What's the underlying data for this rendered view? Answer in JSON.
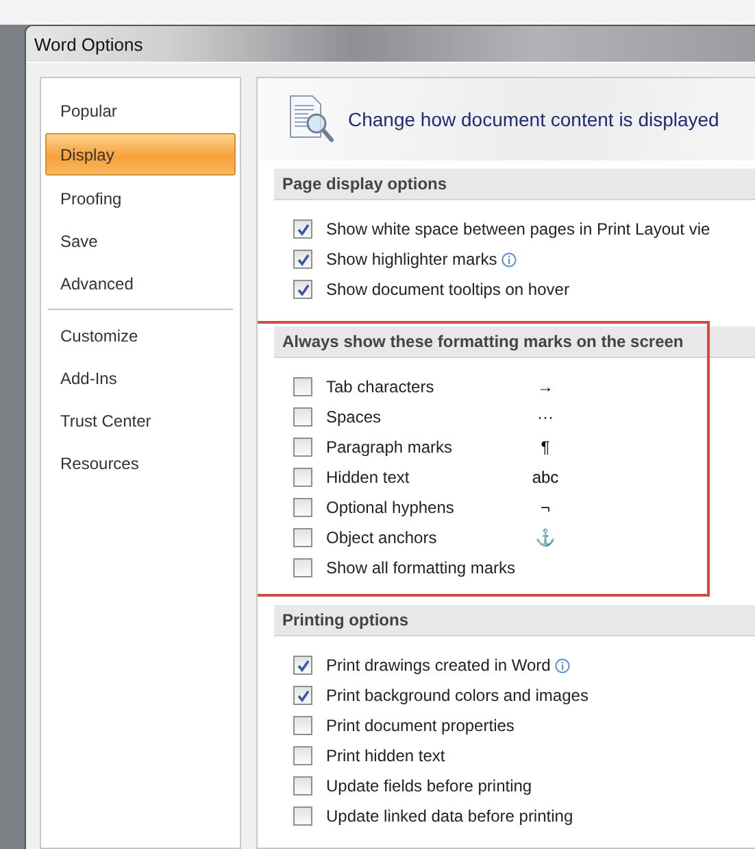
{
  "window": {
    "title": "Word Options"
  },
  "sidebar": {
    "groups": [
      [
        {
          "label": "Popular",
          "selected": false
        },
        {
          "label": "Display",
          "selected": true
        },
        {
          "label": "Proofing",
          "selected": false
        },
        {
          "label": "Save",
          "selected": false
        },
        {
          "label": "Advanced",
          "selected": false
        }
      ],
      [
        {
          "label": "Customize",
          "selected": false
        },
        {
          "label": "Add-Ins",
          "selected": false
        },
        {
          "label": "Trust Center",
          "selected": false
        },
        {
          "label": "Resources",
          "selected": false
        }
      ]
    ]
  },
  "header": {
    "title": "Change how document content is displayed"
  },
  "sections": [
    {
      "title": "Page display options",
      "highlighted": false,
      "options": [
        {
          "label": "Show white space between pages in Print Layout vie",
          "checked": true,
          "info": false
        },
        {
          "label": "Show highlighter marks",
          "checked": true,
          "info": true
        },
        {
          "label": "Show document tooltips on hover",
          "checked": true,
          "info": false
        }
      ]
    },
    {
      "title": "Always show these formatting marks on the screen",
      "highlighted": true,
      "options": [
        {
          "label": "Tab characters",
          "checked": false,
          "info": false,
          "mark": "→"
        },
        {
          "label": "Spaces",
          "checked": false,
          "info": false,
          "mark": "···"
        },
        {
          "label": "Paragraph marks",
          "checked": false,
          "info": false,
          "mark": "¶"
        },
        {
          "label": "Hidden text",
          "checked": false,
          "info": false,
          "mark": "abc"
        },
        {
          "label": "Optional hyphens",
          "checked": false,
          "info": false,
          "mark": "¬"
        },
        {
          "label": "Object anchors",
          "checked": false,
          "info": false,
          "mark": "⚓"
        },
        {
          "label": "Show all formatting marks",
          "checked": false,
          "info": false
        }
      ]
    },
    {
      "title": "Printing options",
      "highlighted": false,
      "options": [
        {
          "label": "Print drawings created in Word",
          "checked": true,
          "info": true
        },
        {
          "label": "Print background colors and images",
          "checked": true,
          "info": false
        },
        {
          "label": "Print document properties",
          "checked": false,
          "info": false
        },
        {
          "label": "Print hidden text",
          "checked": false,
          "info": false
        },
        {
          "label": "Update fields before printing",
          "checked": false,
          "info": false
        },
        {
          "label": "Update linked data before printing",
          "checked": false,
          "info": false
        }
      ]
    }
  ]
}
